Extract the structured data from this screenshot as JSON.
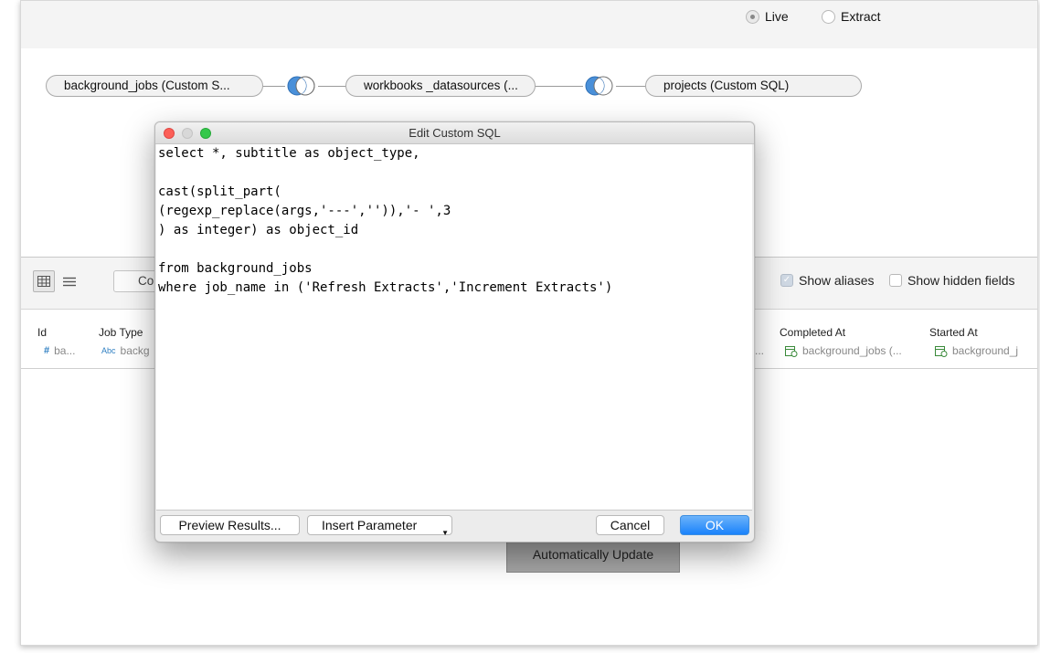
{
  "connection": {
    "options": [
      {
        "label": "Live",
        "selected": true
      },
      {
        "label": "Extract",
        "selected": false
      }
    ]
  },
  "joins": {
    "tables": [
      "background_jobs (Custom S...",
      "workbooks _datasources (...",
      "projects (Custom SQL)"
    ],
    "join_type": "left-join-icon"
  },
  "toolbar": {
    "copy_label": "Copy",
    "show_aliases": {
      "label": "Show aliases",
      "checked": true
    },
    "show_hidden": {
      "label": "Show hidden fields",
      "checked": false
    }
  },
  "grid": {
    "columns": [
      {
        "name": "Id",
        "type": "#",
        "source": "ba..."
      },
      {
        "name": "Job Type",
        "type": "Abc",
        "source": "backg"
      },
      {
        "name": "Completed At",
        "type": "date-icon",
        "source": "background_jobs (..."
      },
      {
        "name": "Started At",
        "type": "date-icon",
        "source": "background_j"
      }
    ],
    "truncated_marker": "..."
  },
  "auto_update_label": "Automatically Update",
  "dialog": {
    "title": "Edit Custom SQL",
    "sql_lines": [
      "select *, subtitle as object_type,",
      "",
      "cast(split_part(",
      "(regexp_replace(args,'---','')),'- ',3",
      ") as integer) as object_id",
      "",
      "from background_jobs",
      "where job_name in ('Refresh Extracts','Increment Extracts')"
    ],
    "buttons": {
      "preview": "Preview Results...",
      "insert_param": "Insert Parameter",
      "cancel": "Cancel",
      "ok": "OK"
    }
  },
  "colors": {
    "accent": "#1a82fb",
    "join_fill": "#4a90d9",
    "traffic_close": "#fc5f57",
    "traffic_min": "#d8d8d8",
    "traffic_max": "#34c84a"
  }
}
